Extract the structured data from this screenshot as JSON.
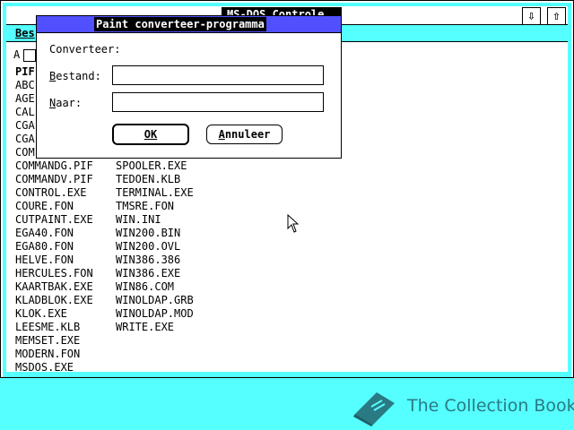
{
  "window": {
    "title": "MS-DOS Controle",
    "scroll_down_glyph": "⇩",
    "scroll_up_glyph": "⇧"
  },
  "menubar": {
    "first_item": "Bes"
  },
  "drive": {
    "letter": "A"
  },
  "files": {
    "column1": [
      "PIF",
      "ABC",
      "AGE",
      "CAL",
      "CGA",
      "CGA",
      "COM",
      "COMMANDG.PIF",
      "COMMANDV.PIF",
      "CONTROL.EXE",
      "COURE.FON",
      "CUTPAINT.EXE",
      "EGA40.FON",
      "EGA80.FON",
      "HELVE.FON",
      "HERCULES.FON",
      "KAARTBAK.EXE",
      "KLADBLOK.EXE",
      "KLOK.EXE",
      "LEESME.KLB",
      "MEMSET.EXE",
      "MODERN.FON",
      "MSDOS.EXE"
    ],
    "column2": [
      "SPOOLER.EXE",
      "TEDOEN.KLB",
      "TERMINAL.EXE",
      "TMSRE.FON",
      "WIN.INI",
      "WIN200.BIN",
      "WIN200.OVL",
      "WIN386.386",
      "WIN386.EXE",
      "WIN86.COM",
      "WINOLDAP.GRB",
      "WINOLDAP.MOD",
      "WRITE.EXE"
    ]
  },
  "dialog": {
    "title": "Paint converteer-programma",
    "heading": "Converteer:",
    "source_label_key": "B",
    "source_label_rest": "estand:",
    "source_value": "",
    "target_label_key": "N",
    "target_label_rest": "aar:",
    "target_value": "",
    "ok_label": "OK",
    "cancel_label_key": "A",
    "cancel_label_rest": "nnuleer"
  },
  "branding": {
    "text": "The Collection Book",
    "color": "#2a7a84"
  },
  "colors": {
    "desktop": "#55ffff",
    "dialog_title": "#5050ff"
  }
}
